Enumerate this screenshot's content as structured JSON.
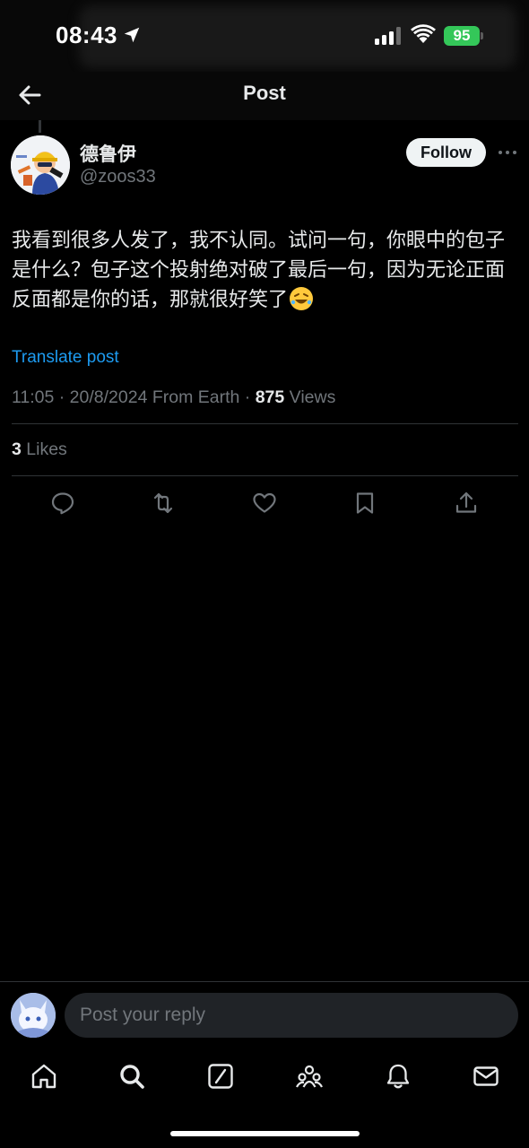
{
  "status_bar": {
    "time": "08:43",
    "battery": "95"
  },
  "header": {
    "title": "Post"
  },
  "author": {
    "name": "德鲁伊",
    "handle": "@zoos33",
    "follow_label": "Follow"
  },
  "post": {
    "text": "我看到很多人发了，我不认同。试问一句，你眼中的包子是什么？包子这个投射绝对破了最后一句，因为无论正面反面都是你的话，那就很好笑了",
    "emoji": "rolling-on-floor-laughing",
    "translate_label": "Translate post",
    "timestamp": "11:05 · 20/8/2024 From Earth · ",
    "views_count": "875",
    "views_label": " Views",
    "likes_count": "3",
    "likes_label": " Likes"
  },
  "actions": [
    "reply-icon",
    "repost-icon",
    "like-icon",
    "bookmark-icon",
    "share-icon"
  ],
  "reply": {
    "placeholder": "Post your reply"
  },
  "nav": [
    "home-icon",
    "search-icon",
    "grok-icon",
    "communities-icon",
    "notifications-icon",
    "messages-icon"
  ],
  "colors": {
    "accent": "#1d9bf0",
    "battery": "#34c759",
    "background": "#000000",
    "secondary_text": "#71767b"
  }
}
